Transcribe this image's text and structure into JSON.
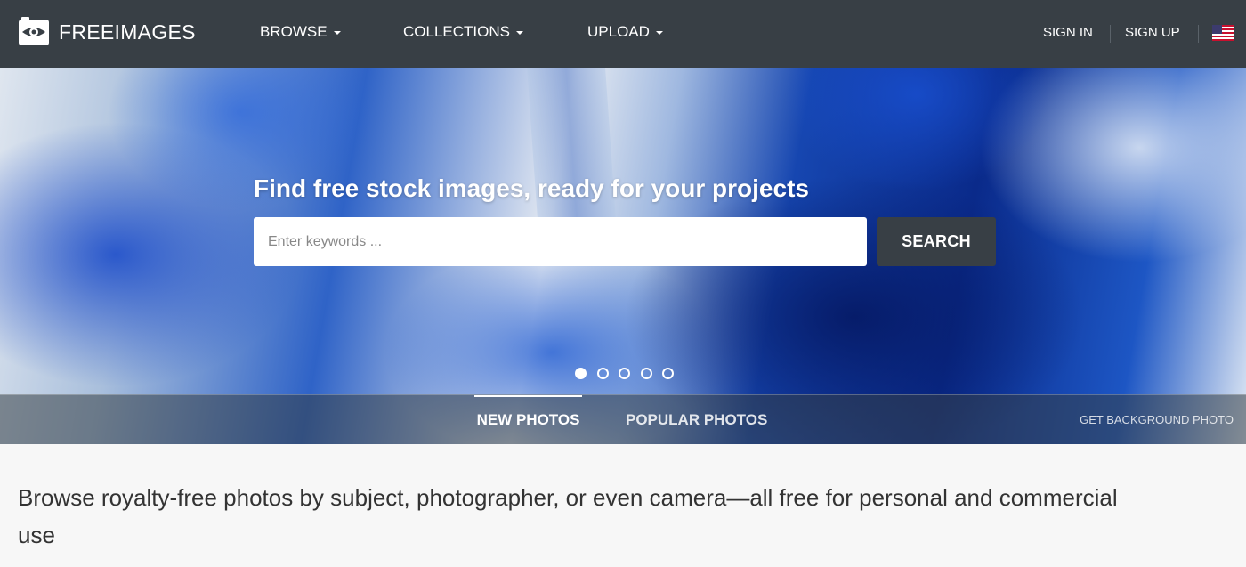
{
  "nav": {
    "logo_text": "FREEIMAGES",
    "menu": [
      {
        "label": "BROWSE"
      },
      {
        "label": "COLLECTIONS"
      },
      {
        "label": "UPLOAD"
      }
    ],
    "sign_in": "SIGN IN",
    "sign_up": "SIGN UP",
    "language_icon": "us-flag-icon"
  },
  "hero": {
    "headline": "Find free stock images, ready for your projects",
    "search_placeholder": "Enter keywords ...",
    "search_value": "",
    "search_button": "SEARCH",
    "slides_total": 5,
    "slide_active": 1,
    "tabs": [
      {
        "label": "NEW PHOTOS",
        "active": true
      },
      {
        "label": "POPULAR PHOTOS",
        "active": false
      }
    ],
    "get_background": "GET BACKGROUND PHOTO"
  },
  "main": {
    "intro": "Browse royalty-free photos by subject, photographer, or even camera—all free for personal and commercial use"
  },
  "colors": {
    "nav_bg": "#383f45",
    "accent_blue": "#1646b0",
    "page_bg": "#f7f7f7"
  }
}
